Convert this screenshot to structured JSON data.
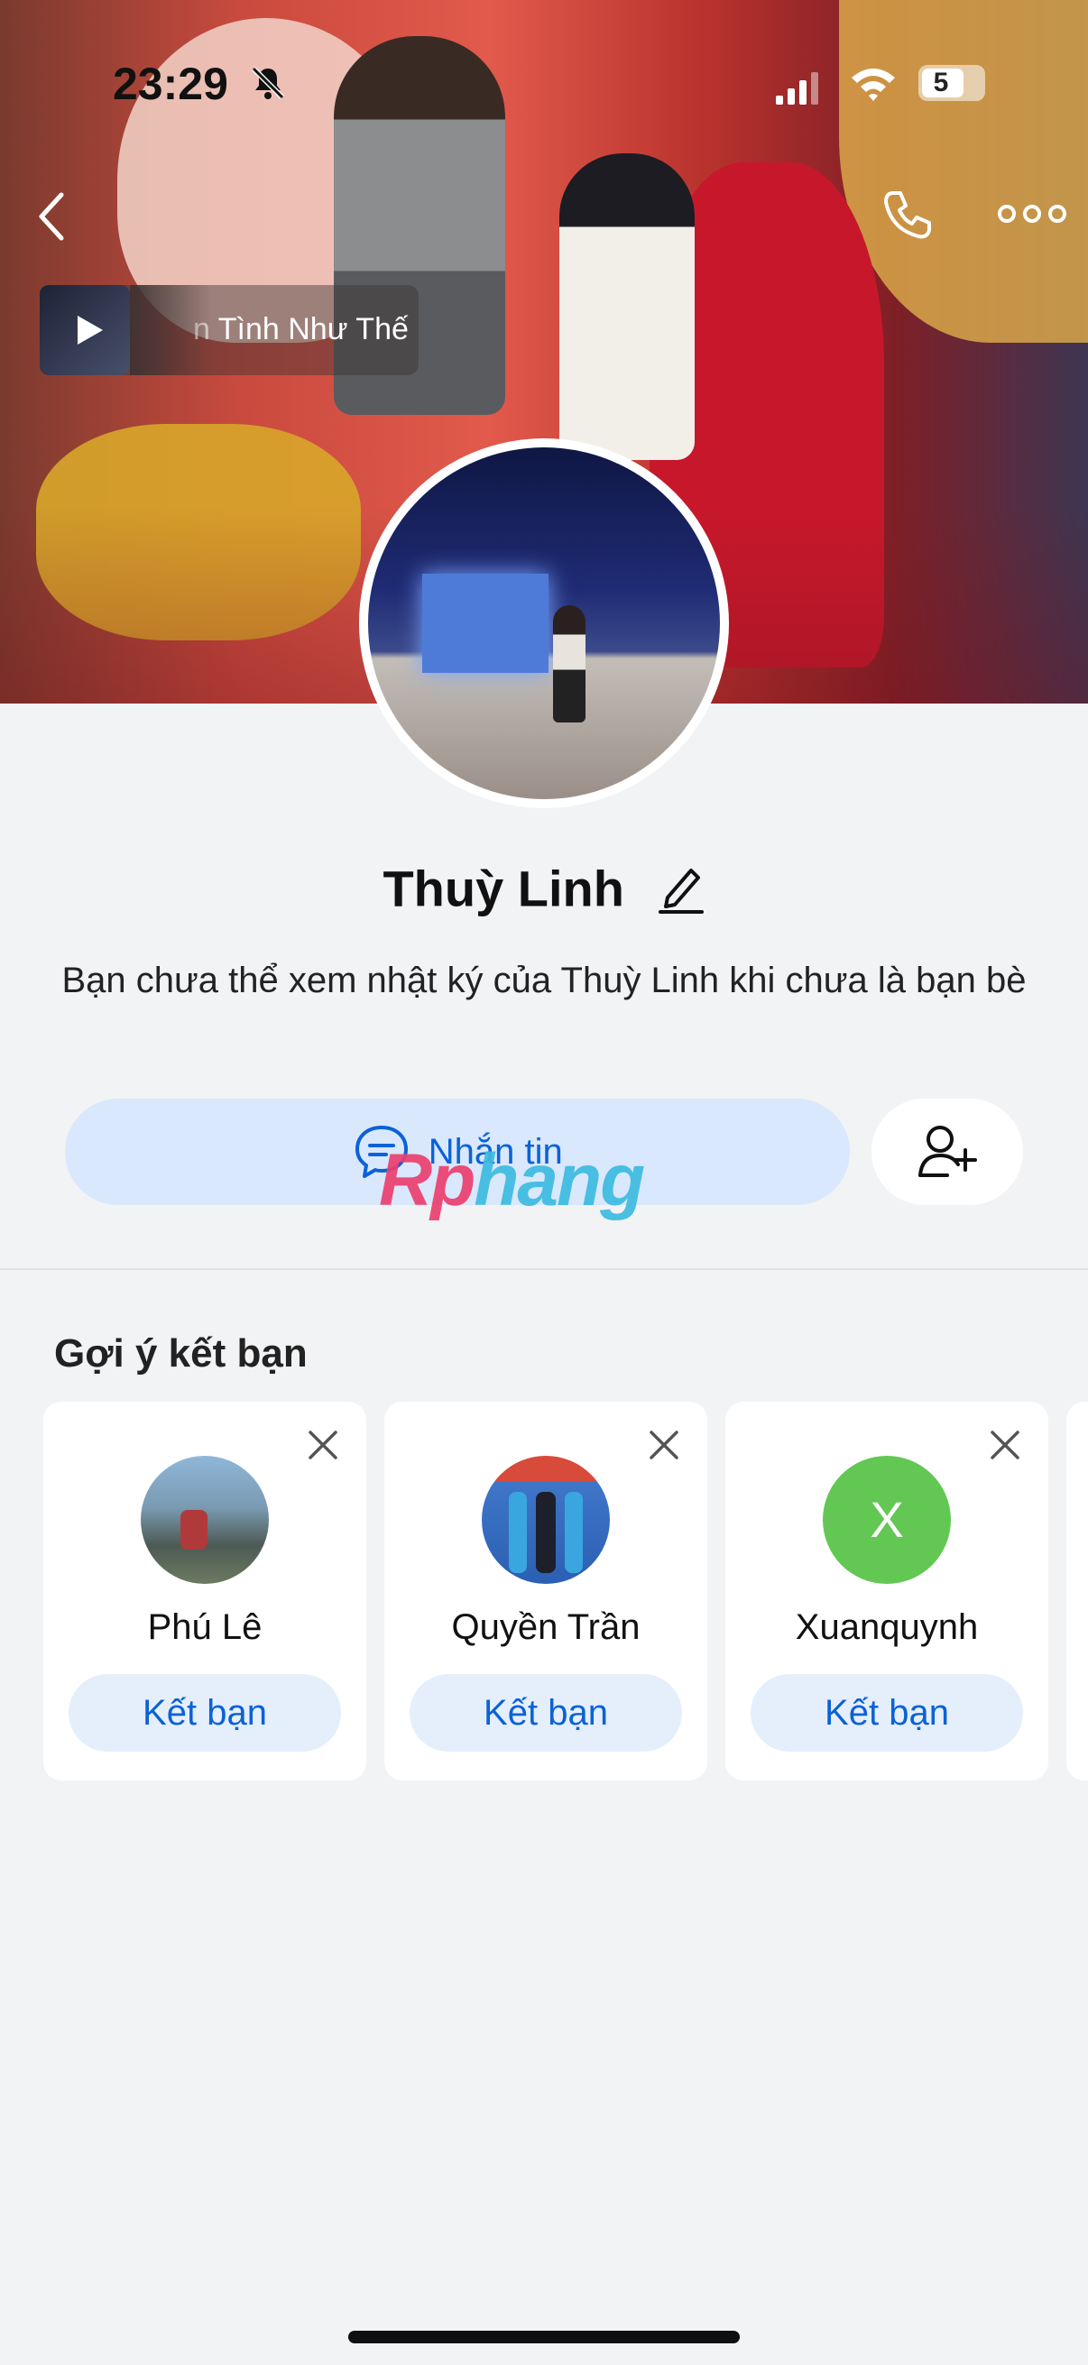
{
  "status_bar": {
    "time": "23:29",
    "battery": "5",
    "battery_level": 0.05
  },
  "nav": {
    "back_icon": "chevron-left-icon",
    "call_icon": "phone-icon",
    "more_icon": "more-icon"
  },
  "music": {
    "title": "Tình Như Thế",
    "partial_prefix": "n"
  },
  "profile": {
    "name": "Thuỳ Linh",
    "notice": "Bạn chưa thể xem nhật ký của Thuỳ Linh khi chưa là bạn bè",
    "message_button": "Nhắn tin"
  },
  "watermark": {
    "part1": "Rp",
    "part2": "hang"
  },
  "suggestions": {
    "title": "Gợi ý kết bạn",
    "items": [
      {
        "name": "Phú Lê",
        "action": "Kết bạn"
      },
      {
        "name": "Quyền Trần",
        "action": "Kết bạn"
      },
      {
        "name": "Xuanquynh",
        "initial": "X",
        "action": "Kết bạn"
      }
    ]
  },
  "colors": {
    "accent": "#0b62d6",
    "button_bg": "#d9e8fd",
    "letter_avatar": "#63c754"
  }
}
